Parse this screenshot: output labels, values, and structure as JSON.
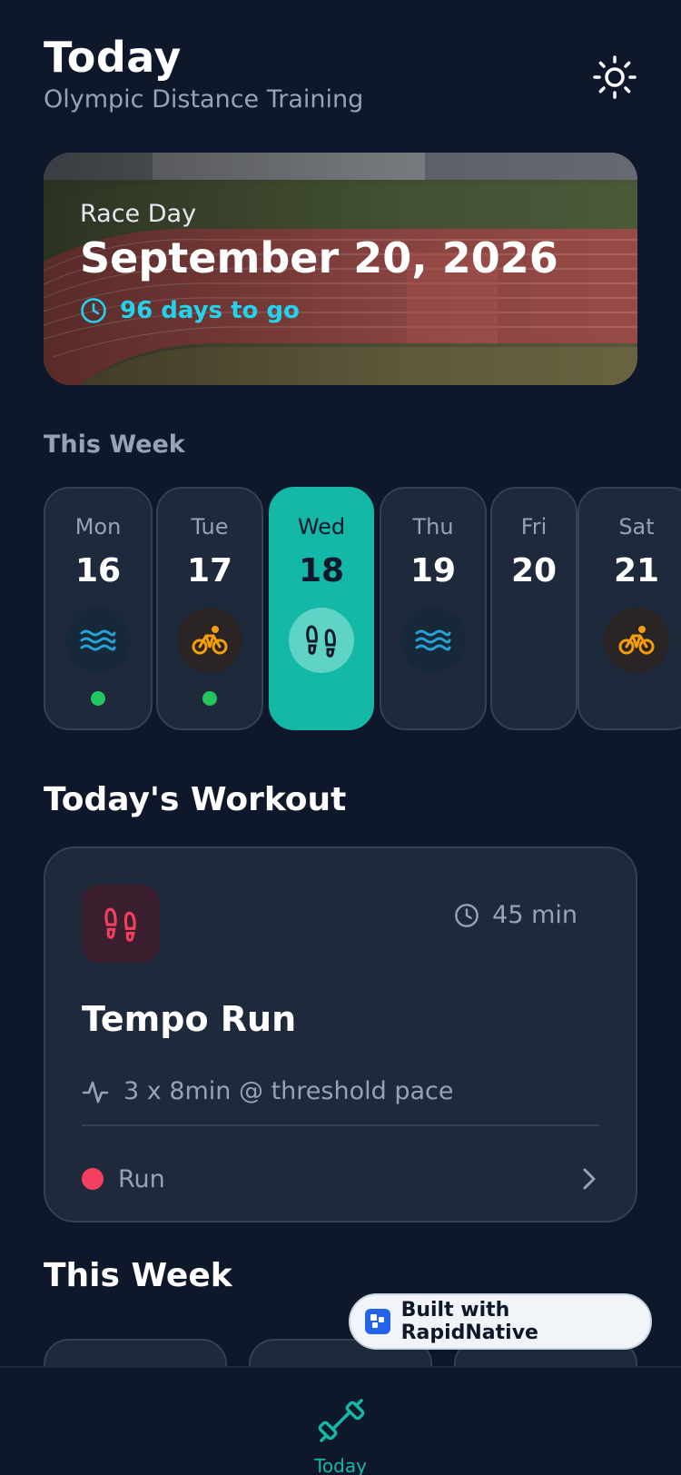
{
  "header": {
    "title": "Today",
    "subtitle": "Olympic Distance Training",
    "theme_icon": "sun-icon"
  },
  "race": {
    "label": "Race Day",
    "date": "September 20, 2026",
    "countdown": "96 days to go",
    "countdown_color": "#22d3ee"
  },
  "week": {
    "heading": "This Week",
    "days": [
      {
        "name": "Mon",
        "num": "16",
        "sport": "swim",
        "completed": true
      },
      {
        "name": "Tue",
        "num": "17",
        "sport": "bike",
        "completed": true
      },
      {
        "name": "Wed",
        "num": "18",
        "sport": "run",
        "active": true
      },
      {
        "name": "Thu",
        "num": "19",
        "sport": "swim"
      },
      {
        "name": "Fri",
        "num": "20",
        "sport": "rest"
      },
      {
        "name": "Sat",
        "num": "21",
        "sport": "bike"
      }
    ]
  },
  "workout": {
    "heading": "Today's Workout",
    "duration": "45 min",
    "title": "Tempo Run",
    "detail": "3 x 8min @ threshold pace",
    "sport_label": "Run",
    "sport_color": "#f43f5e"
  },
  "week_summary": {
    "heading": "This Week"
  },
  "badge": {
    "text": "Built with RapidNative"
  },
  "tabbar": {
    "tab_label": "Today",
    "accent": "#14b8a6"
  }
}
